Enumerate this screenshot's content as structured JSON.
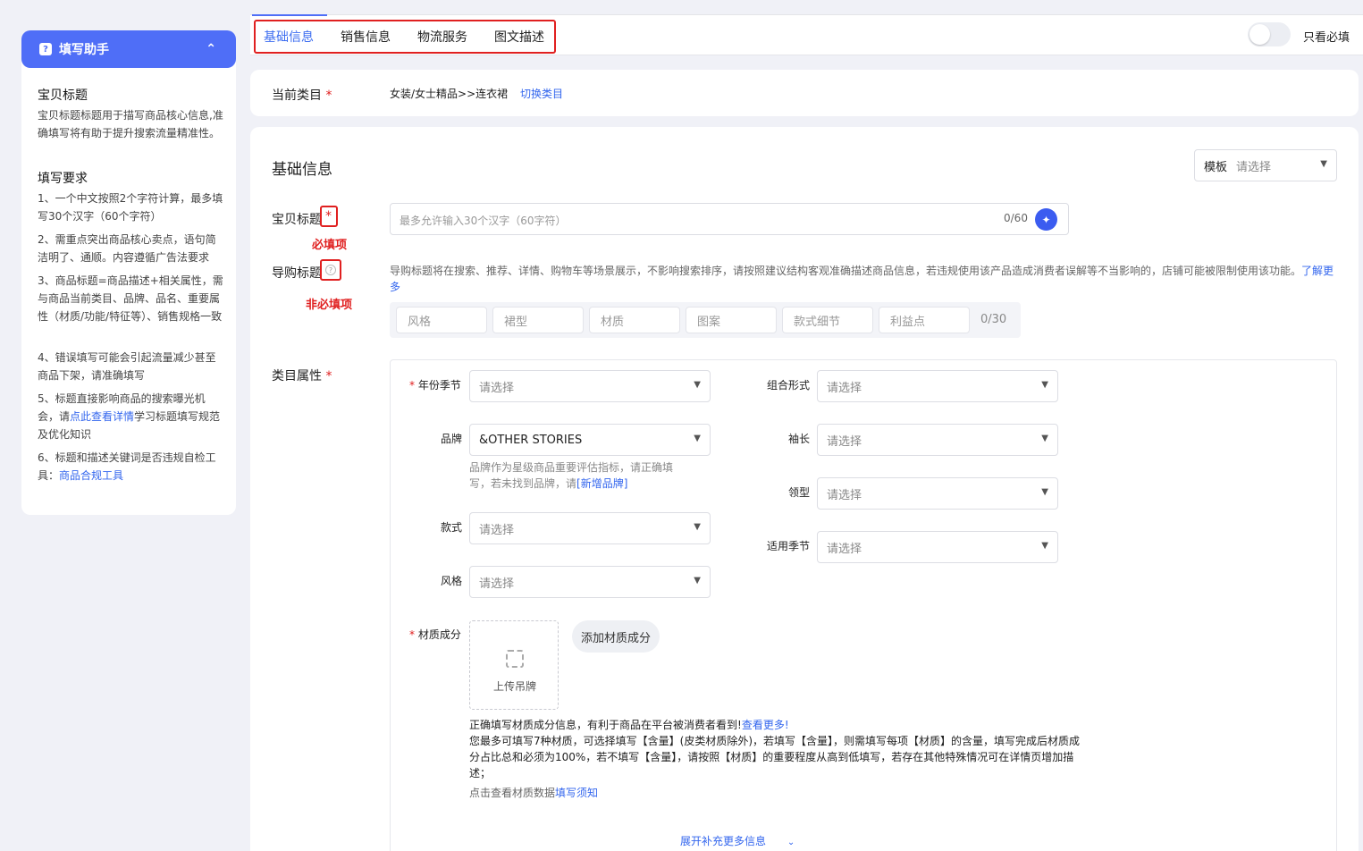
{
  "sidebar": {
    "header": "填写助手",
    "section1_title": "宝贝标题",
    "section1_desc": "宝贝标题标题用于描写商品核心信息,准确填写将有助于提升搜索流量精准性。",
    "section2_title": "填写要求",
    "rules": [
      "1、一个中文按照2个字符计算，最多填写30个汉字（60个字符）",
      "2、需重点突出商品核心卖点，语句简洁明了、通顺。内容遵循广告法要求",
      "3、商品标题=商品描述+相关属性，需与商品当前类目、品牌、品名、重要属性（材质/功能/特征等）、销售规格一致",
      "4、错误填写可能会引起流量减少甚至商品下架，请准确填写"
    ],
    "rule5_prefix": "5、标题直接影响商品的搜索曝光机会，请",
    "rule5_link": "点此查看详情",
    "rule5_suffix": "学习标题填写规范及优化知识",
    "rule6_prefix": "6、标题和描述关键词是否违规自检工具：",
    "rule6_link": "商品合规工具"
  },
  "tabs": [
    "基础信息",
    "销售信息",
    "物流服务",
    "图文描述"
  ],
  "toggle_label": "只看必填",
  "category": {
    "label": "当前类目",
    "value": "女装/女士精品>>连衣裙",
    "switch_link": "切换类目"
  },
  "section_title": "基础信息",
  "template": {
    "label": "模板",
    "placeholder": "请选择"
  },
  "title_field": {
    "label": "宝贝标题",
    "placeholder": "最多允许输入30个汉字（60字符）",
    "counter": "0/60",
    "annotation": "必填项"
  },
  "guide_title": {
    "label": "导购标题",
    "annotation": "非必填项",
    "hint": "导购标题将在搜索、推荐、详情、购物车等场景展示，不影响搜索排序，请按照建议结构客观准确描述商品信息，若违规使用该产品造成消费者误解等不当影响的，店铺可能被限制使用该功能。",
    "hint_link": "了解更多",
    "chips": [
      "风格",
      "裙型",
      "材质",
      "图案",
      "款式细节",
      "利益点"
    ],
    "counter": "0/30"
  },
  "attributes": {
    "label": "类目属性",
    "left": [
      {
        "label": "年份季节",
        "value": "请选择",
        "required": true
      },
      {
        "label": "品牌",
        "value": "&OTHER STORIES",
        "required": false
      },
      {
        "label": "款式",
        "value": "请选择",
        "required": false
      },
      {
        "label": "风格",
        "value": "请选择",
        "required": false
      }
    ],
    "right": [
      {
        "label": "组合形式",
        "value": "请选择"
      },
      {
        "label": "袖长",
        "value": "请选择"
      },
      {
        "label": "领型",
        "value": "请选择"
      },
      {
        "label": "适用季节",
        "value": "请选择"
      }
    ],
    "brand_hint_line1": "品牌作为星级商品重要评估指标，请正确填",
    "brand_hint_line2": "写，若未找到品牌，请",
    "brand_hint_link": "[新增品牌]",
    "material": {
      "label": "材质成分",
      "upload_label": "上传吊牌",
      "add_button": "添加材质成分",
      "line1": "正确填写材质成分信息，有利于商品在平台被消费者看到!",
      "line1_link": "查看更多!",
      "line2": "您最多可填写7种材质，可选择填写【含量】(皮类材质除外)，若填写【含量】，则需填写每项【材质】的含量，填写完成后材质成分占比总和必须为100%，若不填写【含量】，请按照【材质】的重要程度从高到低填写，若存在其他特殊情况可在详情页增加描述；",
      "line3_prefix": "点击查看材质数据",
      "line3_link": "填写须知"
    },
    "expand": "展开补充更多信息"
  }
}
